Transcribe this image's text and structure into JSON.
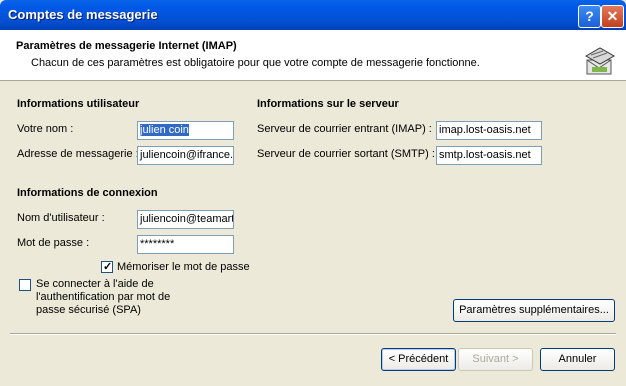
{
  "window": {
    "title": "Comptes de messagerie",
    "help_label": "?",
    "close_label": "✕"
  },
  "header": {
    "title": "Paramètres de messagerie Internet (IMAP)",
    "subtitle": "Chacun de ces paramètres est obligatoire pour que votre compte de messagerie fonctionne.",
    "icon": "mail-settings-icon"
  },
  "user_info": {
    "heading": "Informations utilisateur",
    "name_label": "Votre nom :",
    "name_value": "julien coin",
    "email_label": "Adresse de messagerie :",
    "email_value": "juliencoin@ifrance.c"
  },
  "server_info": {
    "heading": "Informations sur le serveur",
    "incoming_label": "Serveur de courrier entrant (IMAP) :",
    "incoming_value": "imap.lost-oasis.net",
    "outgoing_label": "Serveur de courrier sortant (SMTP) :",
    "outgoing_value": "smtp.lost-oasis.net"
  },
  "logon_info": {
    "heading": "Informations de connexion",
    "username_label": "Nom d'utilisateur :",
    "username_value": "juliencoin@teamarti",
    "password_label": "Mot de passe :",
    "password_value": "********",
    "remember_label": "Mémoriser le mot de passe",
    "remember_checked": true,
    "spa_label_line1": "Se connecter à l'aide de",
    "spa_label_line2": "l'authentification par mot de",
    "spa_label_line3": "passe sécurisé (SPA)",
    "spa_checked": false
  },
  "buttons": {
    "more_settings": "Paramètres supplémentaires...",
    "back": "< Précédent",
    "next": "Suivant >",
    "cancel": "Annuler"
  }
}
